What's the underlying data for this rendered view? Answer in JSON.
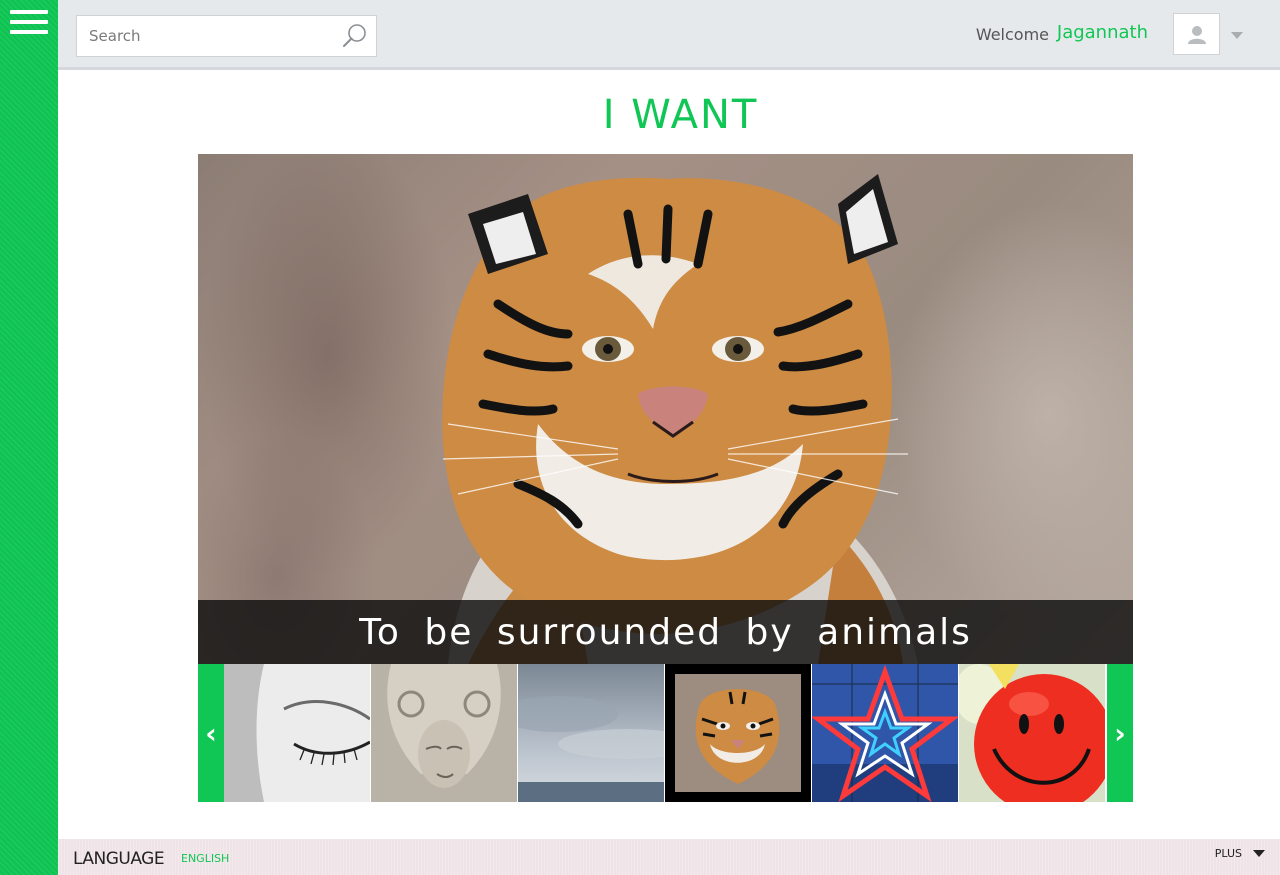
{
  "header": {
    "search_placeholder": "Search",
    "welcome_label": "Welcome",
    "username": "Jagannath"
  },
  "main": {
    "title": "I WANT",
    "caption": "To be surrounded by animals"
  },
  "carousel": {
    "prev_label": "‹",
    "next_label": "›",
    "selected_index": 3,
    "thumbnails": [
      "closed-eye",
      "stone-carving-face",
      "cloudy-sky",
      "tiger",
      "neon-star",
      "smiley-balloon"
    ]
  },
  "footer": {
    "language_label": "LANGUAGE",
    "language_value": "ENGLISH",
    "plus_label": "PLUS"
  },
  "colors": {
    "accent": "#10c654",
    "header_bg": "#e6e9ec",
    "caption_bg": "#0f0f0f",
    "footer_bg": "#efe3e8"
  }
}
